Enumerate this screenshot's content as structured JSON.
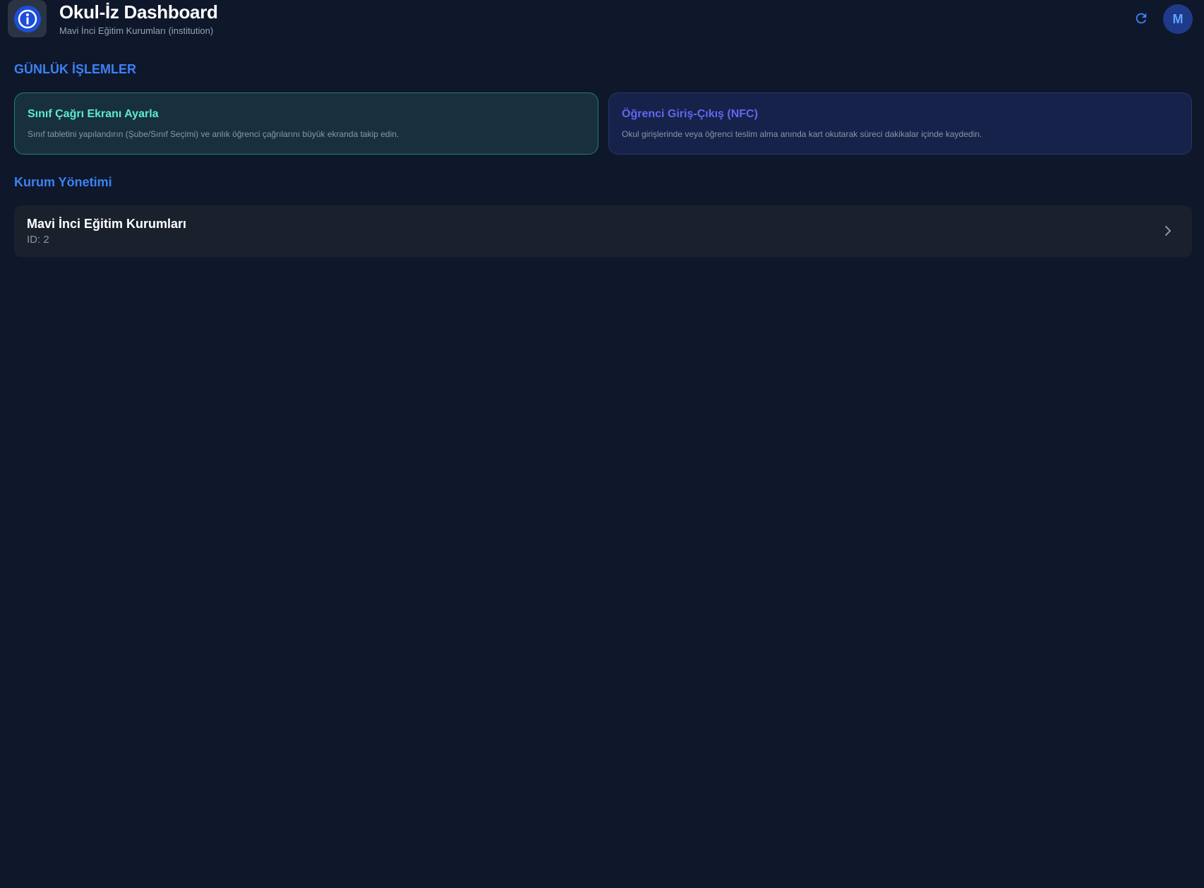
{
  "header": {
    "title": "Okul-İz Dashboard",
    "subtitle": "Mavi İnci Eğitim Kurumları (institution)",
    "logo_icon": "info-icon",
    "refresh_icon": "refresh-icon",
    "avatar_initial": "M"
  },
  "daily": {
    "heading": "GÜNLÜK İŞLEMLER",
    "cards": [
      {
        "title": "Sınıf Çağrı Ekranı Ayarla",
        "description": "Sınıf tabletini yapılandırın (Şube/Sınıf Seçimi) ve anlık öğrenci çağrılarını büyük ekranda takip edin.",
        "accent": "#5eead4"
      },
      {
        "title": "Öğrenci Giriş-Çıkış (NFC)",
        "description": "Okul girişlerinde veya öğrenci teslim alma anında kart okutarak süreci dakikalar içinde kaydedin.",
        "accent": "#6366f1"
      }
    ]
  },
  "management": {
    "heading": "Kurum Yönetimi",
    "institutions": [
      {
        "name": "Mavi İnci Eğitim Kurumları",
        "id_label": "ID: 2",
        "icon": "chevron-right-icon"
      }
    ]
  },
  "colors": {
    "background": "#0f172a",
    "accent_blue": "#3b82f6",
    "teal": "#5eead4",
    "indigo": "#6366f1"
  }
}
